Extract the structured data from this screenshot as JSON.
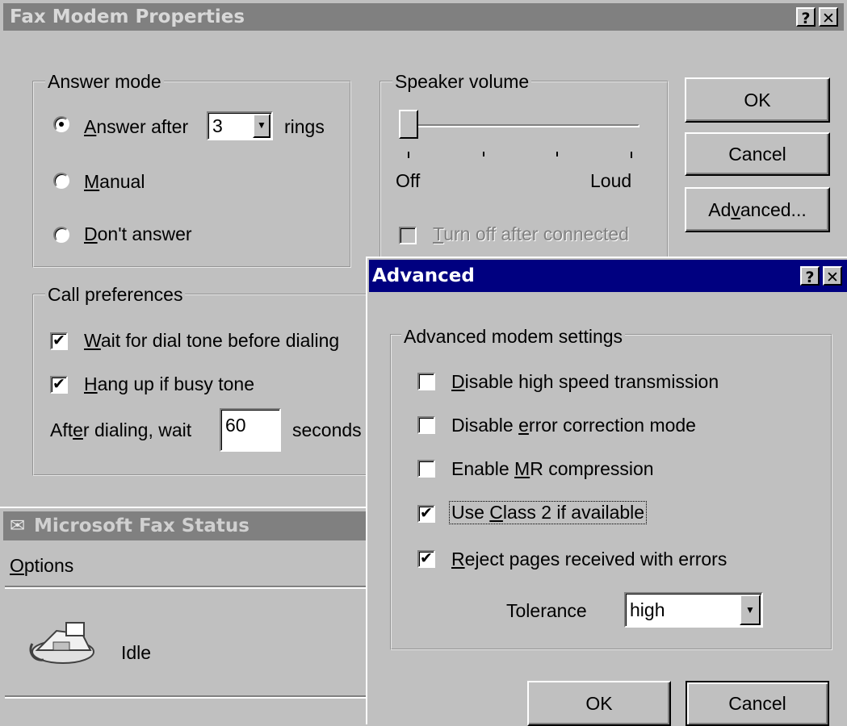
{
  "fax_props": {
    "title": "Fax Modem Properties",
    "help_btn": "?",
    "close_btn": "✕",
    "answer_mode": {
      "label": "Answer mode",
      "answer_after_pre": "A",
      "answer_after_post": "nswer after",
      "rings_value": "3",
      "rings_label": "rings",
      "manual_pre": "M",
      "manual_post": "anual",
      "dont_pre": "D",
      "dont_post": "on't answer"
    },
    "speaker": {
      "label": "Speaker volume",
      "off": "Off",
      "loud": "Loud",
      "level": 0,
      "turn_off_pre": "T",
      "turn_off_post": "urn off after connected"
    },
    "buttons": {
      "ok": "OK",
      "cancel": "Cancel",
      "adv_pre": "Ad",
      "adv_u": "v",
      "adv_post": "anced..."
    },
    "call_prefs": {
      "label": "Call preferences",
      "wait_pre": "W",
      "wait_post": "ait for dial tone before dialing",
      "hang_pre": "H",
      "hang_post": "ang up if busy tone",
      "after_pre": "Aft",
      "after_u": "e",
      "after_post": "r dialing, wait",
      "seconds_value": "60",
      "seconds_label": "seconds"
    }
  },
  "fax_status": {
    "title": "Microsoft Fax Status",
    "menu_options_u": "O",
    "menu_options_rest": "ptions",
    "status": "Idle"
  },
  "advanced": {
    "title": "Advanced",
    "help_btn": "?",
    "close_btn": "✕",
    "group_label": "Advanced  modem settings",
    "opt1_pre": "",
    "opt1_u": "D",
    "opt1_post": "isable high speed transmission",
    "opt2_pre": "Disable ",
    "opt2_u": "e",
    "opt2_post": "rror correction mode",
    "opt3_pre": "Enable ",
    "opt3_u": "M",
    "opt3_post": "R compression",
    "opt4_pre": "Use ",
    "opt4_u": "C",
    "opt4_post": "lass 2 if available",
    "opt5_pre": "",
    "opt5_u": "R",
    "opt5_post": "eject pages received with errors",
    "check_mark": "✔",
    "tolerance_label": "Tolerance",
    "tolerance_value": "high",
    "ok": "OK",
    "cancel": "Cancel"
  },
  "colors": {
    "inactive_title": "#808080",
    "active_title": "#000080",
    "face": "#c0c0c0"
  }
}
